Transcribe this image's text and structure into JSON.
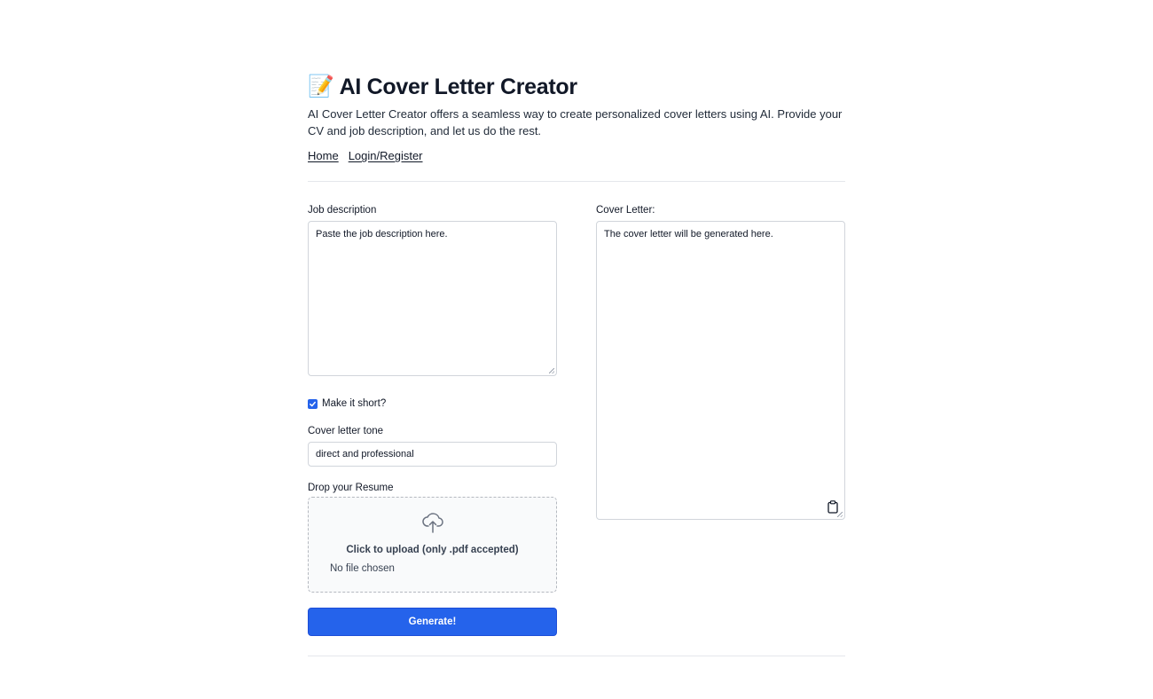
{
  "header": {
    "title_icon": "📝",
    "title": "AI Cover Letter Creator",
    "subtitle": "AI Cover Letter Creator offers a seamless way to create personalized cover letters using AI. Provide your CV and job description, and let us do the rest."
  },
  "nav": {
    "links": [
      {
        "label": "Home"
      },
      {
        "label": "Login/Register"
      }
    ]
  },
  "form": {
    "job_description": {
      "label": "Job description",
      "placeholder": "Paste the job description here."
    },
    "short_option": {
      "label": "Make it short?",
      "checked": true
    },
    "tone": {
      "label": "Cover letter tone",
      "value": "direct and professional"
    },
    "resume": {
      "label": "Drop your Resume",
      "upload_text": "Click to upload (only .pdf accepted)",
      "file_status": "No file chosen",
      "icon": "cloud-upload-icon"
    },
    "generate_label": "Generate!"
  },
  "output": {
    "label": "Cover Letter:",
    "placeholder": "The cover letter will be generated here.",
    "copy_icon": "clipboard-icon"
  },
  "colors": {
    "accent": "#2563eb",
    "border": "#d1d5db",
    "divider": "#e5e7eb"
  }
}
